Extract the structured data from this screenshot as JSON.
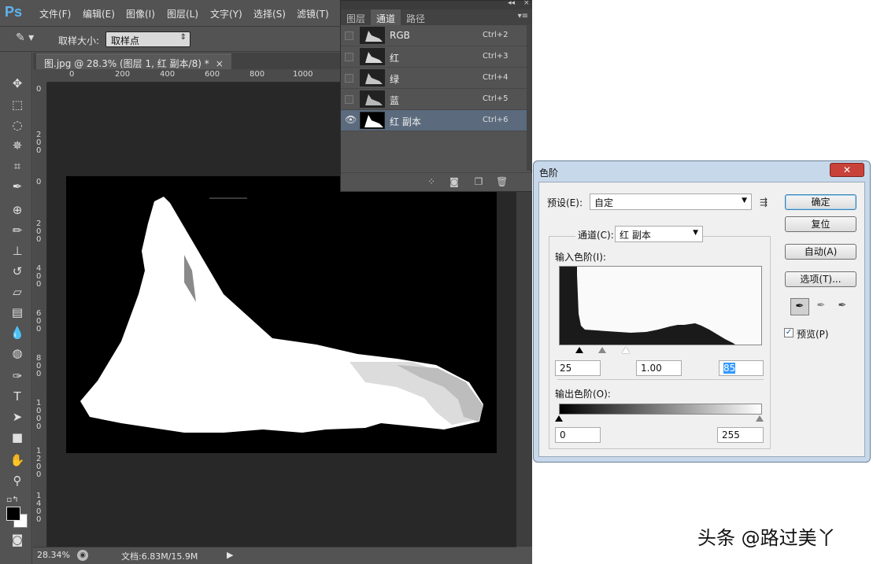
{
  "app": {
    "logo": "Ps",
    "menus": [
      "文件(F)",
      "编辑(E)",
      "图像(I)",
      "图层(L)",
      "文字(Y)",
      "选择(S)",
      "滤镜(T)"
    ]
  },
  "options_bar": {
    "sample_size_label": "取样大小:",
    "sample_size_value": "取样点"
  },
  "document": {
    "tab_title": "图.jpg @ 28.3% (图层 1, 红 副本/8) *",
    "ruler_h": [
      "0",
      "200",
      "400",
      "600",
      "800",
      "1000"
    ],
    "ruler_v": [
      "0",
      "2 0 0",
      "0",
      "2 0 0",
      "4 0 0",
      "6 0 0",
      "8 0 0",
      "1 0 0 0",
      "1 2 0 0",
      "1 4 0 0"
    ],
    "zoom": "28.34%",
    "doc_info": "文档:6.83M/15.9M"
  },
  "channels_panel": {
    "tabs": [
      "图层",
      "通道",
      "路径"
    ],
    "active_tab": "通道",
    "channels": [
      {
        "name": "RGB",
        "shortcut": "Ctrl+2",
        "visible": false,
        "selected": false
      },
      {
        "name": "红",
        "shortcut": "Ctrl+3",
        "visible": false,
        "selected": false
      },
      {
        "name": "绿",
        "shortcut": "Ctrl+4",
        "visible": false,
        "selected": false
      },
      {
        "name": "蓝",
        "shortcut": "Ctrl+5",
        "visible": false,
        "selected": false
      },
      {
        "name": "红 副本",
        "shortcut": "Ctrl+6",
        "visible": true,
        "selected": true
      }
    ]
  },
  "levels_dialog": {
    "title": "色阶",
    "preset_label": "预设(E):",
    "preset_value": "自定",
    "channel_label": "通道(C):",
    "channel_value": "红 副本",
    "input_levels_label": "输入色阶(I):",
    "input_black": "25",
    "input_gamma": "1.00",
    "input_white": "85",
    "output_levels_label": "输出色阶(O):",
    "output_black": "0",
    "output_white": "255",
    "buttons": {
      "ok": "确定",
      "reset": "复位",
      "auto": "自动(A)",
      "options": "选项(T)..."
    },
    "preview_label": "预览(P)",
    "preview_checked": true
  },
  "watermark": "头条 @路过美丫",
  "colors": {
    "ps_bg": "#535353",
    "canvas_bg": "#282828",
    "selected_channel": "#5b6a7d",
    "dialog_frame": "#c7d8ea",
    "close_button": "#c9423a"
  }
}
